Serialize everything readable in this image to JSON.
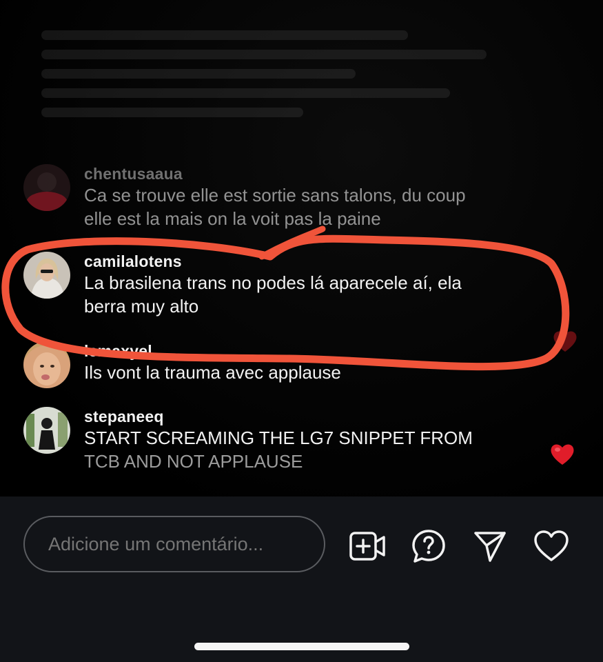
{
  "comments": [
    {
      "username": "chentusaaua",
      "lines": [
        "Ca se trouve elle est sortie sans talons, du coup",
        "elle est la mais on la voit pas la paine"
      ]
    },
    {
      "username": "camilalotens",
      "lines": [
        "La brasilena trans no podes lá aparecele aí, ela",
        "berra muy alto"
      ]
    },
    {
      "username": "lemaxyel",
      "lines": [
        "Ils vont la trauma avec applause"
      ]
    },
    {
      "username": "stepaneeq",
      "lines": [
        "START SCREAMING THE LG7 SNIPPET FROM",
        "TCB AND NOT APPLAUSE"
      ]
    }
  ],
  "input": {
    "placeholder": "Adicione um comentário..."
  },
  "icons": {
    "add_video": "add-video-icon",
    "question": "question-bubble-icon",
    "send": "send-icon",
    "like": "heart-outline-icon",
    "floating_hearts": "red-heart-icon"
  },
  "colors": {
    "highlight": "#f0543a",
    "heart_red": "#e11d2a",
    "bar_bg": "#121418",
    "text": "#f2f2f2"
  }
}
